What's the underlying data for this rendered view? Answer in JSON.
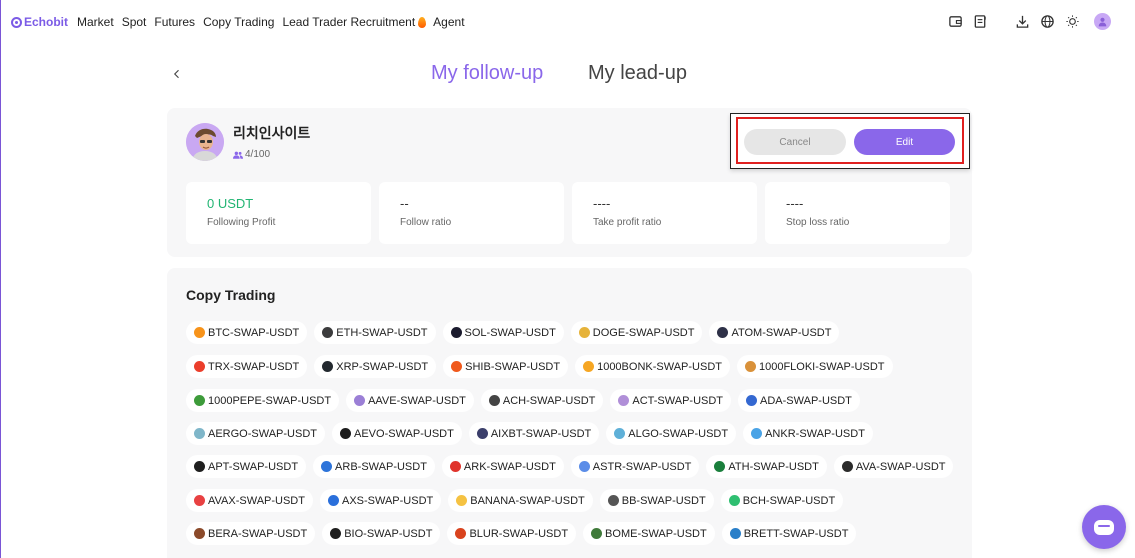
{
  "nav": {
    "brand": "Echobit",
    "items": [
      "Market",
      "Spot",
      "Futures",
      "Copy Trading",
      "Lead Trader Recruitment",
      "Agent"
    ]
  },
  "header": {
    "tabs": [
      "My follow-up",
      "My lead-up"
    ]
  },
  "profile": {
    "name": "리치인사이트",
    "followers": "4/100",
    "stats": [
      {
        "value": "0 USDT",
        "label": "Following Profit"
      },
      {
        "value": "--",
        "label": "Follow ratio"
      },
      {
        "value": "----",
        "label": "Take profit ratio"
      },
      {
        "value": "----",
        "label": "Stop loss ratio"
      }
    ],
    "cancel_label": "Cancel",
    "edit_label": "Edit"
  },
  "copy_trading": {
    "title": "Copy Trading",
    "rows": [
      [
        {
          "label": "BTC-SWAP-USDT",
          "color": "#f7931a"
        },
        {
          "label": "ETH-SWAP-USDT",
          "color": "#3c3c3d"
        },
        {
          "label": "SOL-SWAP-USDT",
          "color": "#1b1b2e"
        },
        {
          "label": "DOGE-SWAP-USDT",
          "color": "#e6b33a"
        },
        {
          "label": "ATOM-SWAP-USDT",
          "color": "#2e3148"
        }
      ],
      [
        {
          "label": "TRX-SWAP-USDT",
          "color": "#eb3e2b"
        },
        {
          "label": "XRP-SWAP-USDT",
          "color": "#23292f"
        },
        {
          "label": "SHIB-SWAP-USDT",
          "color": "#f0591c"
        },
        {
          "label": "1000BONK-SWAP-USDT",
          "color": "#f6a623"
        },
        {
          "label": "1000FLOKI-SWAP-USDT",
          "color": "#d9913a"
        }
      ],
      [
        {
          "label": "1000PEPE-SWAP-USDT",
          "color": "#3d9b3a"
        },
        {
          "label": "AAVE-SWAP-USDT",
          "color": "#9b7fd6"
        },
        {
          "label": "ACH-SWAP-USDT",
          "color": "#444444"
        },
        {
          "label": "ACT-SWAP-USDT",
          "color": "#b08fd8"
        },
        {
          "label": "ADA-SWAP-USDT",
          "color": "#3468d1"
        }
      ],
      [
        {
          "label": "AERGO-SWAP-USDT",
          "color": "#7fb6c9"
        },
        {
          "label": "AEVO-SWAP-USDT",
          "color": "#1d1d1d"
        },
        {
          "label": "AIXBT-SWAP-USDT",
          "color": "#3b3f6b"
        },
        {
          "label": "ALGO-SWAP-USDT",
          "color": "#5fb0d8"
        },
        {
          "label": "ANKR-SWAP-USDT",
          "color": "#4aa3e6"
        }
      ],
      [
        {
          "label": "APT-SWAP-USDT",
          "color": "#1f1f1f"
        },
        {
          "label": "ARB-SWAP-USDT",
          "color": "#2d74da"
        },
        {
          "label": "ARK-SWAP-USDT",
          "color": "#e0342c"
        },
        {
          "label": "ASTR-SWAP-USDT",
          "color": "#5b8de8"
        },
        {
          "label": "ATH-SWAP-USDT",
          "color": "#1a7f3c"
        },
        {
          "label": "AVA-SWAP-USDT",
          "color": "#2b2b2b"
        }
      ],
      [
        {
          "label": "AVAX-SWAP-USDT",
          "color": "#e84142"
        },
        {
          "label": "AXS-SWAP-USDT",
          "color": "#2a6fdb"
        },
        {
          "label": "BANANA-SWAP-USDT",
          "color": "#f5c242"
        },
        {
          "label": "BB-SWAP-USDT",
          "color": "#555555"
        },
        {
          "label": "BCH-SWAP-USDT",
          "color": "#2fbf71"
        }
      ],
      [
        {
          "label": "BERA-SWAP-USDT",
          "color": "#8b4a2a"
        },
        {
          "label": "BIO-SWAP-USDT",
          "color": "#1f1f1f"
        },
        {
          "label": "BLUR-SWAP-USDT",
          "color": "#d9431e"
        },
        {
          "label": "BOME-SWAP-USDT",
          "color": "#3f7a3a"
        },
        {
          "label": "BRETT-SWAP-USDT",
          "color": "#2a7fc9"
        }
      ]
    ]
  }
}
